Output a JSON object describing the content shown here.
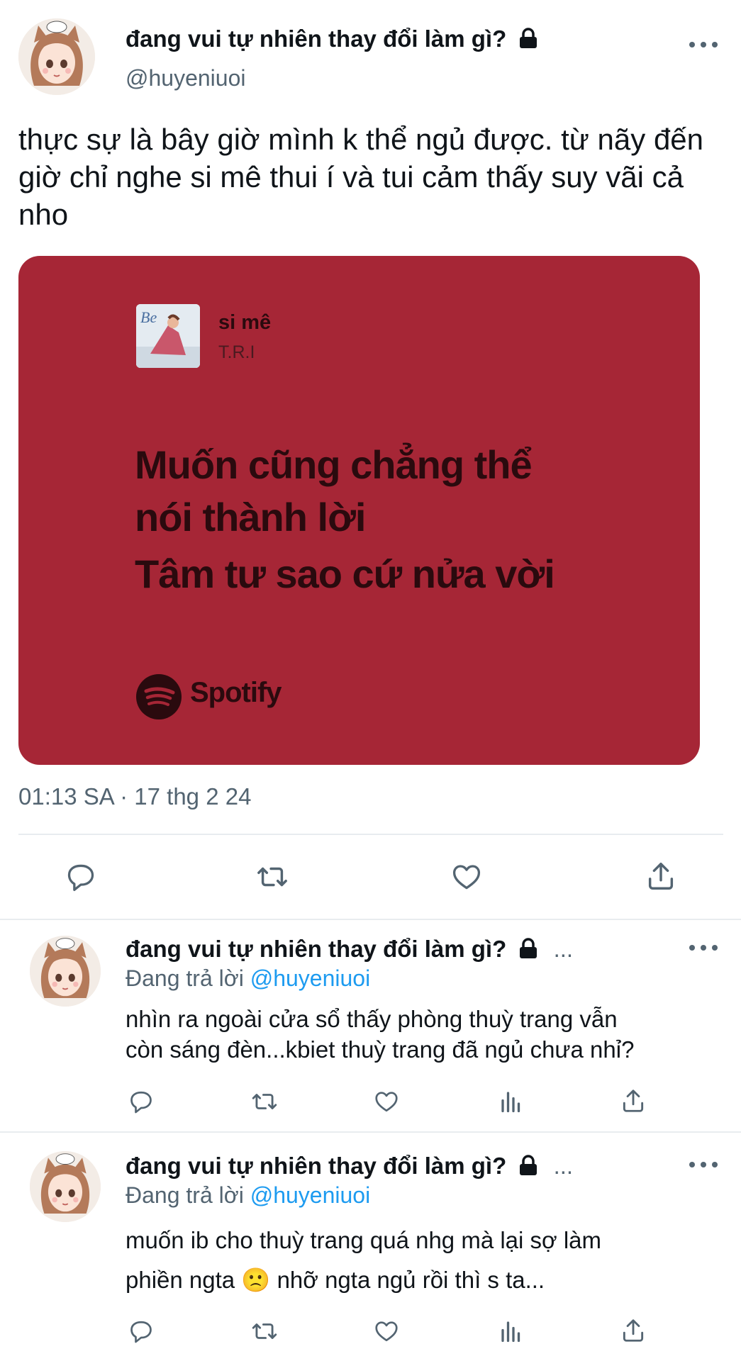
{
  "main_tweet": {
    "display_name": "đang vui tự nhiên thay đổi làm gì?",
    "handle": "@huyeniuoi",
    "text": "thực sự là bây giờ mình k thể ngủ được. từ nãy đến giờ chỉ nghe si mê thui í và tui cảm thấy suy vãi cả nho",
    "card": {
      "song_title": "si mê",
      "artist": "T.R.I",
      "lyric_lines": [
        "Muốn cũng chẳng thể",
        "nói thành lời",
        "Tâm tư sao cứ nửa vời"
      ],
      "brand": "Spotify"
    },
    "timestamp": "01:13 SA · 17 thg 2 24"
  },
  "replies": [
    {
      "display_name": "đang vui tự nhiên thay đổi làm gì?",
      "name_tail": "...",
      "reply_prefix": "Đang trả lời",
      "reply_to": "@huyeniuoi",
      "text_line1": "nhìn ra ngoài cửa sổ thấy phòng thuỳ trang vẫn",
      "text_line2": "còn sáng đèn...kbiet thuỳ trang đã ngủ chưa nhỉ?"
    },
    {
      "display_name": "đang vui tự nhiên thay đổi làm gì?",
      "name_tail": "...",
      "reply_prefix": "Đang trả lời",
      "reply_to": "@huyeniuoi",
      "text_line1": "muốn ib cho thuỳ trang quá nhg mà lại sợ làm",
      "text_line2": "phiền ngta 🙁 nhỡ ngta ngủ rồi thì s ta..."
    }
  ],
  "icons": [
    "reply-icon",
    "retweet-icon",
    "like-icon",
    "views-icon",
    "share-icon",
    "lock-icon",
    "more-icon",
    "spotify-icon"
  ],
  "colors": {
    "card_bg": "#a62636",
    "mention": "#1d9bf0",
    "secondary": "#536471"
  }
}
